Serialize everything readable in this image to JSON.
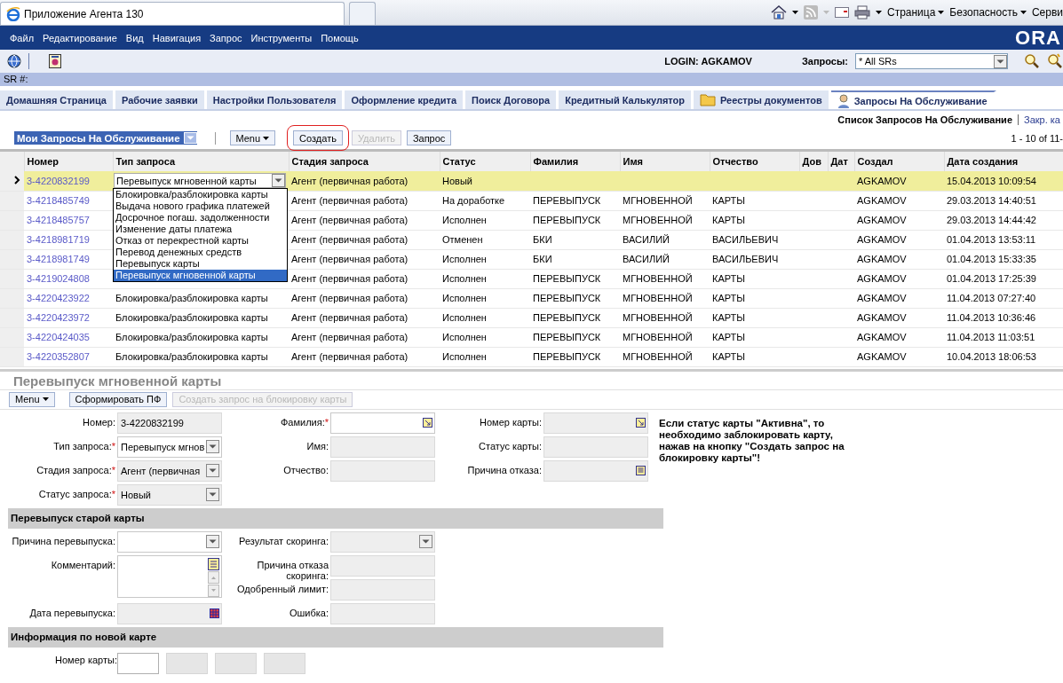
{
  "browser": {
    "tab_title": "Приложение Агента 130",
    "commands": [
      "Страница",
      "Безопасность",
      "Серви"
    ]
  },
  "menu_bar": {
    "items": [
      "Файл",
      "Редактирование",
      "Вид",
      "Навигация",
      "Запрос",
      "Инструменты",
      "Помощь"
    ],
    "logo": "ORA"
  },
  "toolbar": {
    "login": "LOGIN: AGKAMOV",
    "queries_label": "Запросы:",
    "queries_value": "* All SRs"
  },
  "sr_label": "SR #:",
  "tabs": [
    {
      "label": "Домашняя Страница",
      "selected": false
    },
    {
      "label": "Рабочие заявки",
      "selected": false
    },
    {
      "label": "Настройки Пользователя",
      "selected": false
    },
    {
      "label": "Оформление кредита",
      "selected": false
    },
    {
      "label": "Поиск Договора",
      "selected": false
    },
    {
      "label": "Кредитный Калькулятор",
      "selected": false
    },
    {
      "label": "Реестры документов",
      "selected": false,
      "kind": "folder"
    },
    {
      "label": "Запросы На Обслуживание",
      "selected": true,
      "kind": "person"
    }
  ],
  "list_header": {
    "title": "Список Запросов На Обслуживание",
    "link": "Закр. ка"
  },
  "applet": {
    "view": "Мои Запросы На Обслуживание",
    "buttons": [
      {
        "label": "Menu",
        "kind": "menu",
        "disabled": false,
        "highlighted": false
      },
      {
        "label": "Создать",
        "kind": "button",
        "disabled": false,
        "highlighted": true
      },
      {
        "label": "Удалить",
        "kind": "button",
        "disabled": true,
        "highlighted": false
      },
      {
        "label": "Запрос",
        "kind": "button",
        "disabled": false,
        "highlighted": false
      }
    ],
    "pager": "1 - 10 of 11-"
  },
  "table": {
    "columns": [
      "Номер",
      "Тип запроса",
      "Стадия запроса",
      "Статус",
      "Фамилия",
      "Имя",
      "Отчество",
      "Дов",
      "Дат",
      "Создал",
      "Дата создания"
    ],
    "rows": [
      {
        "number": "3-4220832199",
        "stage": "Агент (первичная работа)",
        "status": "Новый",
        "created_by": "AGKAMOV",
        "created_at": "15.04.2013 10:09:54",
        "selected": true
      },
      {
        "number": "3-4218485749",
        "stage": "Агент (первичная работа)",
        "status": "На доработке",
        "last_name": "ПЕРЕВЫПУСК",
        "first_name": "МГНОВЕННОЙ",
        "middle_name": "КАРТЫ",
        "created_by": "AGKAMOV",
        "created_at": "29.03.2013 14:40:51",
        "selected": false
      },
      {
        "number": "3-4218485757",
        "stage": "Агент (первичная работа)",
        "status": "Исполнен",
        "last_name": "ПЕРЕВЫПУСК",
        "first_name": "МГНОВЕННОЙ",
        "middle_name": "КАРТЫ",
        "created_by": "AGKAMOV",
        "created_at": "29.03.2013 14:44:42",
        "selected": false
      },
      {
        "number": "3-4218981719",
        "stage": "Агент (первичная работа)",
        "status": "Отменен",
        "last_name": "БКИ",
        "first_name": "ВАСИЛИЙ",
        "middle_name": "ВАСИЛЬЕВИЧ",
        "created_by": "AGKAMOV",
        "created_at": "01.04.2013 13:53:11",
        "selected": false
      },
      {
        "number": "3-4218981749",
        "stage": "Агент (первичная работа)",
        "status": "Исполнен",
        "last_name": "БКИ",
        "first_name": "ВАСИЛИЙ",
        "middle_name": "ВАСИЛЬЕВИЧ",
        "created_by": "AGKAMOV",
        "created_at": "01.04.2013 15:33:35",
        "selected": false
      },
      {
        "number": "3-4219024808",
        "stage": "Агент (первичная работа)",
        "status": "Исполнен",
        "last_name": "ПЕРЕВЫПУСК",
        "first_name": "МГНОВЕННОЙ",
        "middle_name": "КАРТЫ",
        "created_by": "AGKAMOV",
        "created_at": "01.04.2013 17:25:39",
        "selected": false
      },
      {
        "number": "3-4220423922",
        "type": "Блокировка/разблокировка карты",
        "stage": "Агент (первичная работа)",
        "status": "Исполнен",
        "last_name": "ПЕРЕВЫПУСК",
        "first_name": "МГНОВЕННОЙ",
        "middle_name": "КАРТЫ",
        "created_by": "AGKAMOV",
        "created_at": "11.04.2013 07:27:40",
        "selected": false
      },
      {
        "number": "3-4220423972",
        "type": "Блокировка/разблокировка карты",
        "stage": "Агент (первичная работа)",
        "status": "Исполнен",
        "last_name": "ПЕРЕВЫПУСК",
        "first_name": "МГНОВЕННОЙ",
        "middle_name": "КАРТЫ",
        "created_by": "AGKAMOV",
        "created_at": "11.04.2013 10:36:46",
        "selected": false
      },
      {
        "number": "3-4220424035",
        "type": "Блокировка/разблокировка карты",
        "stage": "Агент (первичная работа)",
        "status": "Исполнен",
        "last_name": "ПЕРЕВЫПУСК",
        "first_name": "МГНОВЕННОЙ",
        "middle_name": "КАРТЫ",
        "created_by": "AGKAMOV",
        "created_at": "11.04.2013 11:03:51",
        "selected": false
      },
      {
        "number": "3-4220352807",
        "type": "Блокировка/разблокировка карты",
        "stage": "Агент (первичная работа)",
        "status": "Исполнен",
        "last_name": "ПЕРЕВЫПУСК",
        "first_name": "МГНОВЕННОЙ",
        "middle_name": "КАРТЫ",
        "created_by": "AGKAMOV",
        "created_at": "10.04.2013 18:06:53",
        "selected": false
      }
    ],
    "type_editor": {
      "value": "Перевыпуск мгновенной карты",
      "expanded": true,
      "options": [
        {
          "label": "Блокировка/разблокировка карты",
          "selected": false
        },
        {
          "label": "Выдача нового графика платежей",
          "selected": false
        },
        {
          "label": "Досрочное погаш. задолженности",
          "selected": false
        },
        {
          "label": "Изменение даты платежа",
          "selected": false
        },
        {
          "label": "Отказ от перекрестной карты",
          "selected": false
        },
        {
          "label": "Перевод денежных средств",
          "selected": false
        },
        {
          "label": "Перевыпуск карты",
          "selected": false
        },
        {
          "label": "Перевыпуск мгновенной карты",
          "selected": true
        }
      ]
    }
  },
  "form": {
    "title": "Перевыпуск мгновенной карты",
    "buttons": [
      {
        "label": "Menu",
        "kind": "menu",
        "disabled": false
      },
      {
        "label": "Сформировать ПФ",
        "kind": "button",
        "disabled": false
      },
      {
        "label": "Создать запрос на блокировку карты",
        "kind": "button",
        "disabled": true
      }
    ],
    "columns": [
      [
        {
          "label": "Номер:",
          "value": "3-4220832199",
          "kind": "text",
          "editable": false
        },
        {
          "label": "Тип запроса:",
          "value": "Перевыпуск мгнов",
          "kind": "select",
          "required_mark": "*",
          "editable": true
        },
        {
          "label": "Стадия запроса:",
          "value": "Агент (первичная",
          "kind": "select",
          "required_mark": "*",
          "editable": false
        },
        {
          "label": "Статус запроса:",
          "value": "Новый",
          "kind": "select",
          "required_mark": "*",
          "editable": false
        }
      ],
      [
        {
          "label": "Фамилия:",
          "kind": "pick",
          "required_mark": "*",
          "editable": true
        },
        {
          "label": "Имя:",
          "kind": "text",
          "editable": false
        },
        {
          "label": "Отчество:",
          "kind": "text",
          "editable": false
        }
      ],
      [
        {
          "label": "Номер карты:",
          "kind": "pick",
          "editable": false
        },
        {
          "label": "Статус карты:",
          "kind": "text",
          "editable": false
        },
        {
          "label": "Причина отказа:",
          "kind": "note",
          "editable": false
        }
      ]
    ],
    "note": "Если статус карты \"Активна\", то необходимо заблокировать карту, нажав на кнопку \"Создать запрос на блокировку карты\"!",
    "sections": [
      {
        "title": "Перевыпуск старой карты",
        "columns": [
          [
            {
              "label": "Причина перевыпуска:",
              "kind": "select",
              "editable": true
            },
            {
              "label": "Комментарий:",
              "kind": "textarea",
              "editable": true
            },
            {
              "label": "Дата перевыпуска:",
              "kind": "date",
              "editable": false
            }
          ],
          [
            {
              "label": "Результат скоринга:",
              "kind": "select",
              "editable": false
            },
            {
              "label": "Причина отказа скоринга:",
              "kind": "text",
              "editable": false
            },
            {
              "label": "Одобренный лимит:",
              "kind": "text",
              "editable": false
            },
            {
              "label": "Ошибка:",
              "kind": "text",
              "editable": false
            }
          ]
        ]
      },
      {
        "title": "Информация по новой карте",
        "card_number": {
          "label": "Номер карты:",
          "parts": [
            {
              "editable": true
            },
            {
              "editable": false
            },
            {
              "editable": false
            },
            {
              "editable": false
            }
          ]
        }
      }
    ]
  }
}
